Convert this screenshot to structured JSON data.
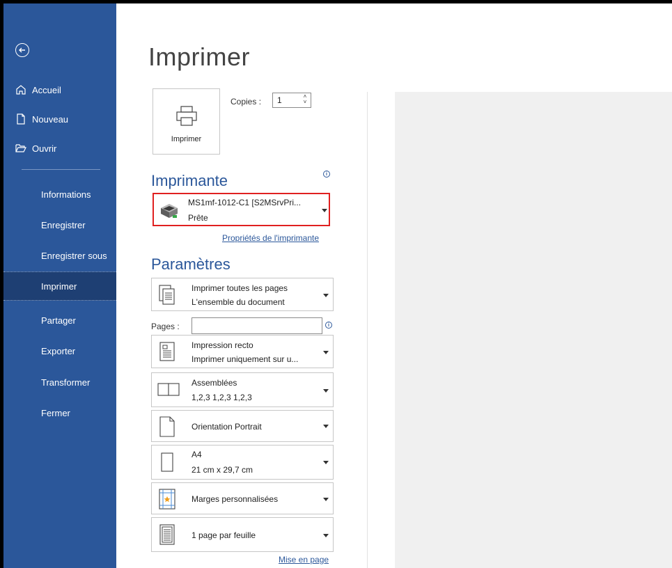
{
  "sidebar": {
    "top_items": [
      {
        "label": "Accueil",
        "icon": "home-icon"
      },
      {
        "label": "Nouveau",
        "icon": "new-document-icon"
      },
      {
        "label": "Ouvrir",
        "icon": "open-folder-icon"
      }
    ],
    "items": [
      {
        "label": "Informations"
      },
      {
        "label": "Enregistrer"
      },
      {
        "label": "Enregistrer sous"
      },
      {
        "label": "Imprimer",
        "active": true
      },
      {
        "label": "Partager"
      },
      {
        "label": "Exporter"
      },
      {
        "label": "Transformer"
      },
      {
        "label": "Fermer"
      }
    ]
  },
  "main": {
    "title": "Imprimer",
    "print_button_label": "Imprimer",
    "copies_label": "Copies :",
    "copies_value": "1"
  },
  "printer": {
    "section_title": "Imprimante",
    "name": "MS1mf-1012-C1 [S2MSrvPri...",
    "status": "Prête",
    "properties_link": "Propriétés de l'imprimante"
  },
  "settings": {
    "section_title": "Paramètres",
    "pages_label": "Pages :",
    "pages_value": "",
    "options": [
      {
        "line1": "Imprimer toutes les pages",
        "line2": "L'ensemble du document",
        "icon": "pages-icon"
      },
      {
        "line1": "Impression recto",
        "line2": "Imprimer uniquement sur u...",
        "icon": "one-sided-icon"
      },
      {
        "line1": "Assemblées",
        "line2": "1,2,3   1,2,3   1,2,3",
        "icon": "collated-icon"
      },
      {
        "line1": "Orientation Portrait",
        "line2": "",
        "icon": "portrait-icon"
      },
      {
        "line1": "A4",
        "line2": "21 cm x 29,7 cm",
        "icon": "paper-size-icon"
      },
      {
        "line1": "Marges personnalisées",
        "line2": "",
        "icon": "margins-icon"
      },
      {
        "line1": "1 page par feuille",
        "line2": "",
        "icon": "pages-per-sheet-icon"
      }
    ],
    "page_setup_link": "Mise en page"
  },
  "colors": {
    "sidebar_bg": "#2b579a",
    "sidebar_active": "#1e3f73",
    "accent": "#2b579a",
    "highlight_border": "#e02020"
  }
}
